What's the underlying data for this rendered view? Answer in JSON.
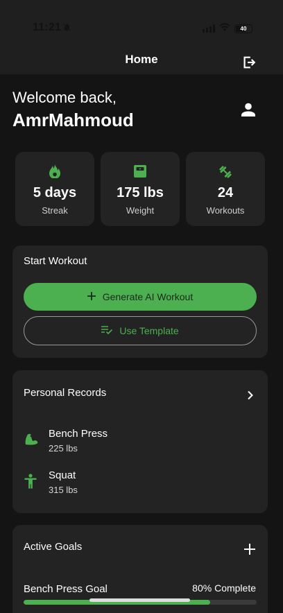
{
  "status_bar": {
    "time": "11:21",
    "battery": "40"
  },
  "app_bar": {
    "title": "Home"
  },
  "welcome": {
    "greeting": "Welcome back,",
    "username": "AmrMahmoud"
  },
  "stats": [
    {
      "icon": "flame-icon",
      "value": "5 days",
      "label": "Streak"
    },
    {
      "icon": "scale-icon",
      "value": "175 lbs",
      "label": "Weight"
    },
    {
      "icon": "dumbbell-icon",
      "value": "24",
      "label": "Workouts"
    }
  ],
  "start_workout": {
    "title": "Start Workout",
    "generate_label": "Generate AI Workout",
    "template_label": "Use Template"
  },
  "personal_records": {
    "title": "Personal Records",
    "items": [
      {
        "icon": "bicep-icon",
        "name": "Bench Press",
        "weight": "225 lbs"
      },
      {
        "icon": "person-icon",
        "name": "Squat",
        "weight": "315 lbs"
      }
    ]
  },
  "active_goals": {
    "title": "Active Goals",
    "goals": [
      {
        "name": "Bench Press Goal",
        "progress_label": "80% Complete",
        "progress": 0.8
      }
    ]
  },
  "colors": {
    "accent": "#4caf50",
    "background": "#141414",
    "card": "#232323"
  }
}
